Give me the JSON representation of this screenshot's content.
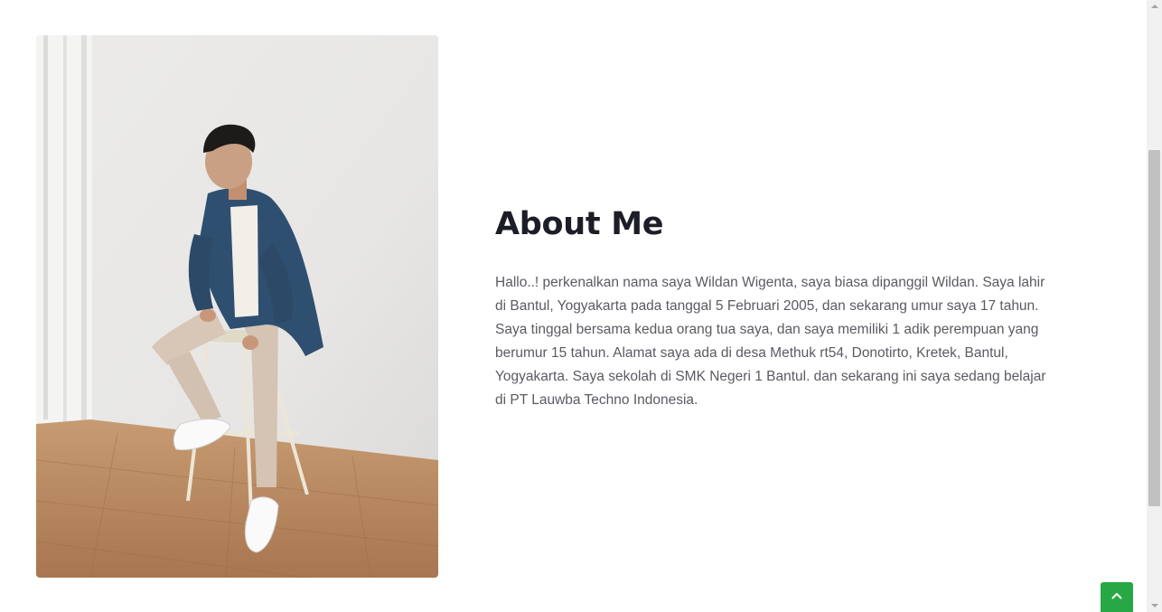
{
  "about": {
    "heading": "About Me",
    "body": "Hallo..! perkenalkan nama saya Wildan Wigenta, saya biasa dipanggil Wildan. Saya lahir di Bantul, Yogyakarta pada tanggal 5 Februari 2005, dan sekarang umur saya 17 tahun. Saya tinggal bersama kedua orang tua saya, dan saya memiliki 1 adik perempuan yang berumur 15 tahun. Alamat saya ada di desa Methuk rt54, Donotirto, Kretek, Bantul, Yogyakarta. Saya sekolah di SMK Negeri 1 Bantul. dan sekarang ini saya sedang belajar di PT Lauwba Techno Indonesia."
  },
  "back_to_top": {
    "icon": "chevron-up-icon",
    "color": "#28a745"
  },
  "colors": {
    "heading": "#1c1d26",
    "body_text": "#5a5b63",
    "accent": "#28a745"
  }
}
